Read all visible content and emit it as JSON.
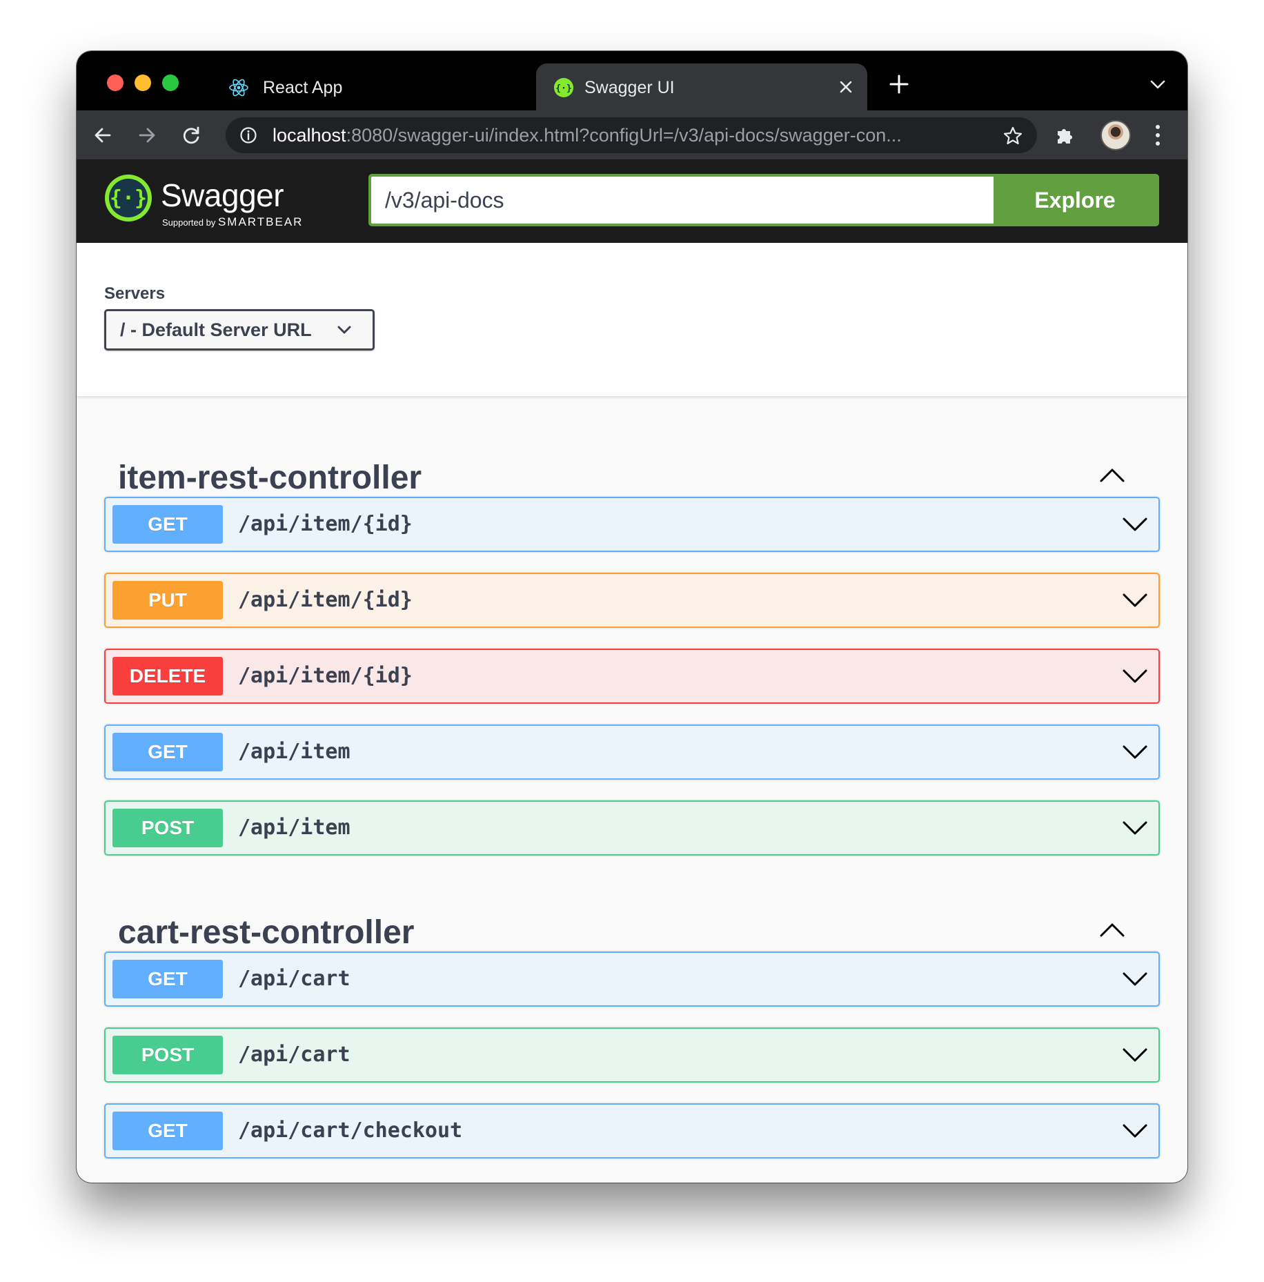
{
  "browser": {
    "tabs": [
      {
        "title": "React App",
        "icon": "react-icon"
      },
      {
        "title": "Swagger UI",
        "icon": "swagger-icon",
        "active": true
      }
    ],
    "url_host": "localhost",
    "url_rest": ":8080/swagger-ui/index.html?configUrl=/v3/api-docs/swagger-con..."
  },
  "swagger": {
    "brand": "Swagger",
    "supported_by": "Supported by",
    "smartbear": "SMARTBEAR",
    "explore_value": "/v3/api-docs",
    "explore_label": "Explore",
    "accent_color": "#62a03f"
  },
  "servers": {
    "label": "Servers",
    "selected": "/ - Default Server URL"
  },
  "tags": [
    {
      "name": "item-rest-controller",
      "operations": [
        {
          "method": "GET",
          "path": "/api/item/{id}"
        },
        {
          "method": "PUT",
          "path": "/api/item/{id}"
        },
        {
          "method": "DELETE",
          "path": "/api/item/{id}"
        },
        {
          "method": "GET",
          "path": "/api/item"
        },
        {
          "method": "POST",
          "path": "/api/item"
        }
      ]
    },
    {
      "name": "cart-rest-controller",
      "operations": [
        {
          "method": "GET",
          "path": "/api/cart"
        },
        {
          "method": "POST",
          "path": "/api/cart"
        },
        {
          "method": "GET",
          "path": "/api/cart/checkout"
        }
      ]
    }
  ],
  "method_colors": {
    "GET": "#61affe",
    "PUT": "#fca130",
    "DELETE": "#f93e3e",
    "POST": "#49cc90"
  }
}
